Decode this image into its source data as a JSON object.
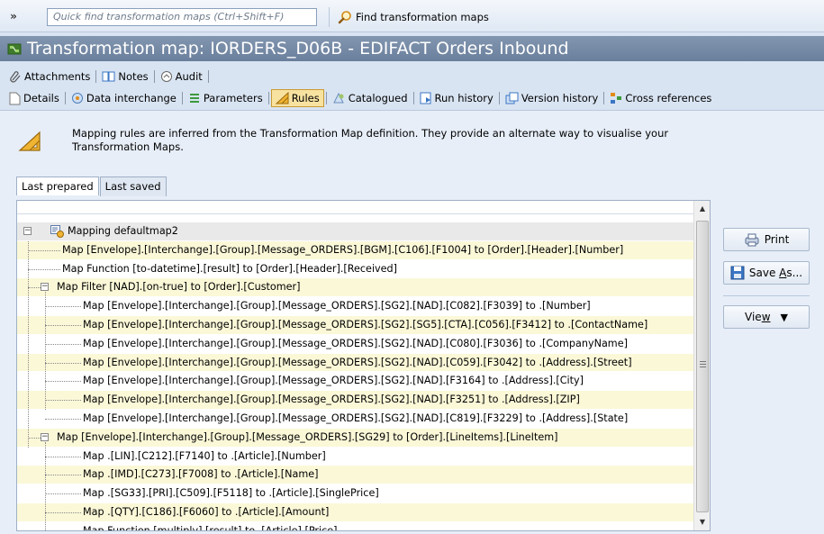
{
  "toolbar": {
    "quickfind_placeholder": "Quick find transformation maps (Ctrl+Shift+F)",
    "find_label": "Find transformation maps"
  },
  "window": {
    "title": "Transformation map: IORDERS_D06B - EDIFACT Orders Inbound"
  },
  "tabs_top": [
    "Attachments",
    "Notes",
    "Audit"
  ],
  "tabs_main": [
    "Details",
    "Data interchange",
    "Parameters",
    "Rules",
    "Catalogued",
    "Run history",
    "Version history",
    "Cross references"
  ],
  "active_tab": "Rules",
  "info_text": "Mapping rules are inferred from the Transformation Map definition.  They provide an alternate way to visualise your Transformation Maps.",
  "subtabs": [
    "Last prepared",
    "Last saved"
  ],
  "active_subtab": "Last prepared",
  "tree": {
    "root": "Mapping defaultmap2",
    "rows": [
      "Map [Envelope].[Interchange].[Group].[Message_ORDERS].[BGM].[C106].[F1004] to [Order].[Header].[Number]",
      "Map Function [to-datetime].[result] to [Order].[Header].[Received]",
      "Map Filter [NAD].[on-true] to [Order].[Customer]",
      "Map [Envelope].[Interchange].[Group].[Message_ORDERS].[SG2].[NAD].[C082].[F3039] to .[Number]",
      "Map [Envelope].[Interchange].[Group].[Message_ORDERS].[SG2].[SG5].[CTA].[C056].[F3412] to .[ContactName]",
      "Map [Envelope].[Interchange].[Group].[Message_ORDERS].[SG2].[NAD].[C080].[F3036] to .[CompanyName]",
      "Map [Envelope].[Interchange].[Group].[Message_ORDERS].[SG2].[NAD].[C059].[F3042] to .[Address].[Street]",
      "Map [Envelope].[Interchange].[Group].[Message_ORDERS].[SG2].[NAD].[F3164] to .[Address].[City]",
      "Map [Envelope].[Interchange].[Group].[Message_ORDERS].[SG2].[NAD].[F3251] to .[Address].[ZIP]",
      "Map [Envelope].[Interchange].[Group].[Message_ORDERS].[SG2].[NAD].[C819].[F3229] to .[Address].[State]",
      "Map [Envelope].[Interchange].[Group].[Message_ORDERS].[SG29] to [Order].[LineItems].[LineItem]",
      "Map .[LIN].[C212].[F7140] to .[Article].[Number]",
      "Map .[IMD].[C273].[F7008] to .[Article].[Name]",
      "Map .[SG33].[PRI].[C509].[F5118] to .[Article].[SinglePrice]",
      "Map .[QTY].[C186].[F6060] to .[Article].[Amount]",
      "Map Function [multiply].[result] to .[Article].[Price]"
    ]
  },
  "side_buttons": {
    "print": "Print",
    "save_as_prefix": "Save ",
    "save_as_ul": "A",
    "save_as_suffix": "s...",
    "view_prefix": "Vie",
    "view_ul": "w"
  }
}
